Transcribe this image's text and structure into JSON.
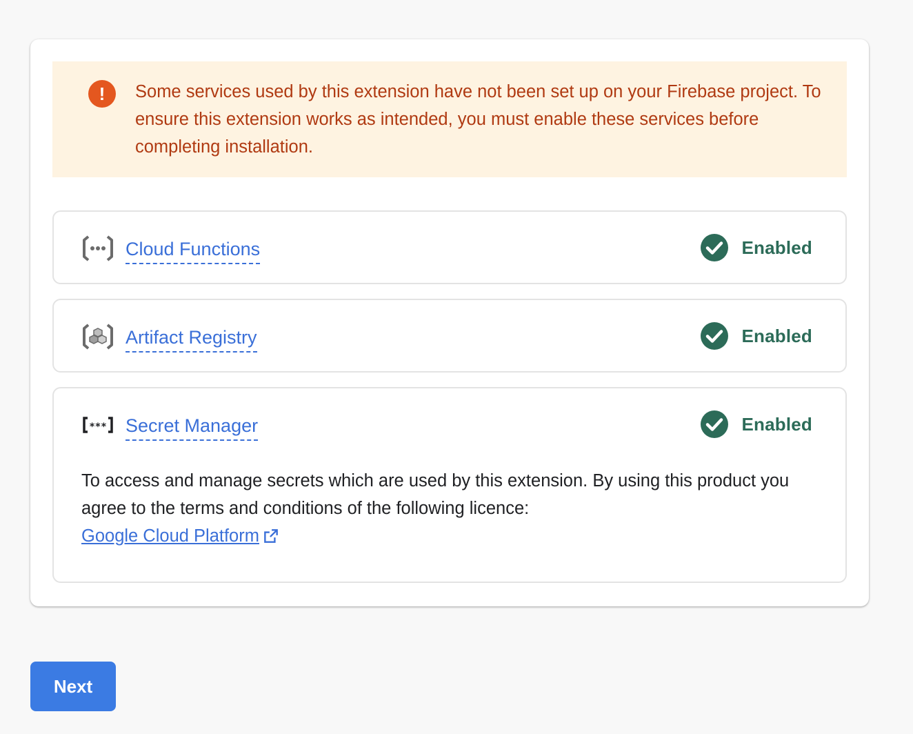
{
  "warning": {
    "text": "Some services used by this extension have not been set up on your Firebase project. To ensure this extension works as intended, you must enable these services before completing installation.",
    "icon": "exclamation-icon",
    "color": "#b03a12",
    "background": "#fef3e1"
  },
  "services": [
    {
      "name": "Cloud Functions",
      "icon": "cloud-functions-icon",
      "status": "Enabled"
    },
    {
      "name": "Artifact Registry",
      "icon": "artifact-registry-icon",
      "status": "Enabled"
    },
    {
      "name": "Secret Manager",
      "icon": "secret-manager-icon",
      "status": "Enabled",
      "description": "To access and manage secrets which are used by this extension. By using this product you agree to the terms and conditions of the following licence:",
      "license_link": "Google Cloud Platform"
    }
  ],
  "status_color": "#2c6b58",
  "link_color": "#3a6fd8",
  "next_button": {
    "label": "Next",
    "color": "#3b7be3"
  }
}
